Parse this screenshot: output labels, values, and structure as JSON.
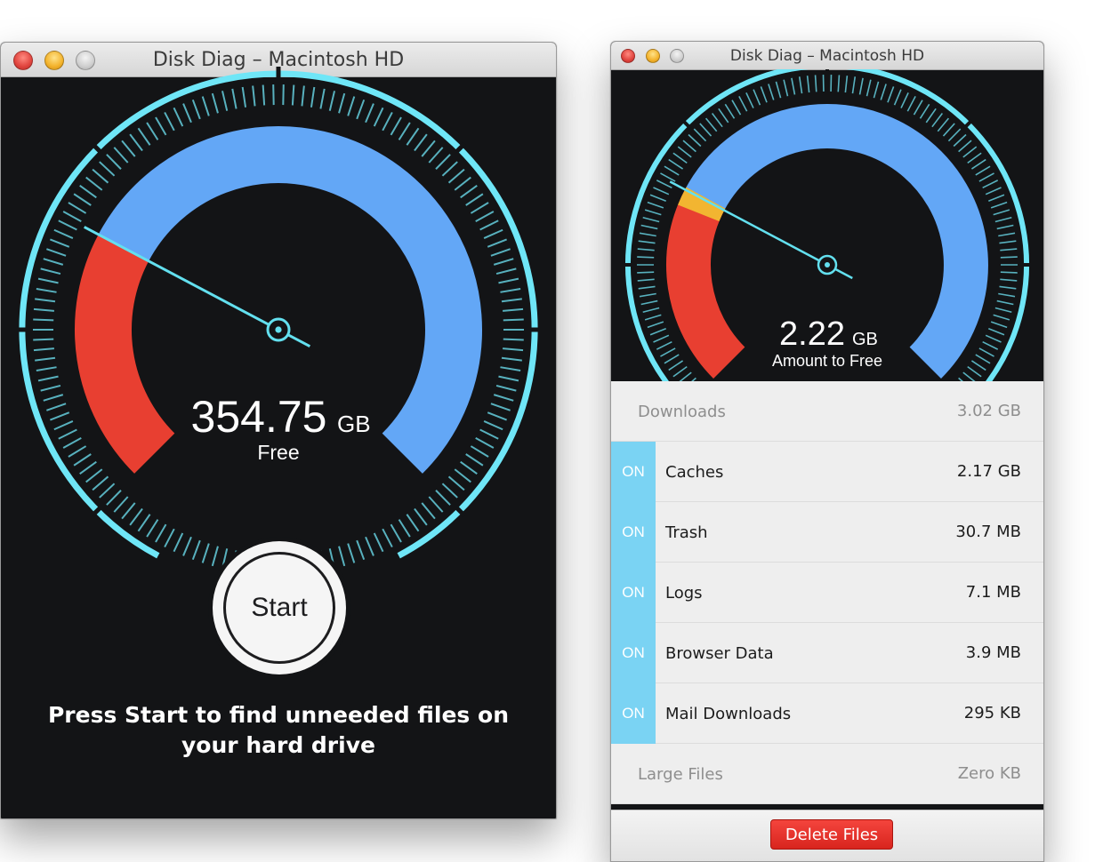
{
  "colors": {
    "used": "#e83f31",
    "free": "#63a7f6",
    "reclaim": "#f2b531",
    "ring": "#6fe6f7",
    "needle": "#63e0ef",
    "on_tab": "#7ad3f3",
    "delete": "#e2322b"
  },
  "left_window": {
    "title": "Disk Diag – Macintosh HD",
    "gauge": {
      "value": "354.75",
      "unit": "GB",
      "label": "Free",
      "used_fraction": 0.27
    },
    "start_label": "Start",
    "instructions_line1": "Press Start to find unneeded files on",
    "instructions_line2": "your hard drive"
  },
  "right_window": {
    "title": "Disk Diag – Macintosh HD",
    "gauge": {
      "value": "2.22",
      "unit": "GB",
      "label": "Amount to Free",
      "used_fraction": 0.27
    },
    "items": [
      {
        "name": "Downloads",
        "size": "3.02 GB",
        "toggle": ""
      },
      {
        "name": "Caches",
        "size": "2.17 GB",
        "toggle": "ON"
      },
      {
        "name": "Trash",
        "size": "30.7 MB",
        "toggle": "ON"
      },
      {
        "name": "Logs",
        "size": "7.1 MB",
        "toggle": "ON"
      },
      {
        "name": "Browser Data",
        "size": "3.9 MB",
        "toggle": "ON"
      },
      {
        "name": "Mail Downloads",
        "size": "295 KB",
        "toggle": "ON"
      },
      {
        "name": "Large Files",
        "size": "Zero KB",
        "toggle": ""
      }
    ],
    "delete_label": "Delete Files"
  }
}
